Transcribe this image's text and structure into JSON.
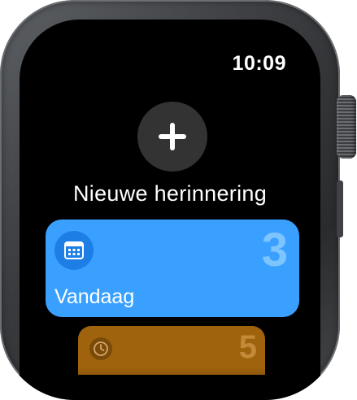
{
  "status": {
    "time": "10:09"
  },
  "add": {
    "icon": "plus-icon",
    "label": "Nieuwe herinnering"
  },
  "lists": [
    {
      "icon": "calendar-icon",
      "count": "3",
      "label": "Vandaag",
      "color": "#3aa0ff"
    },
    {
      "icon": "clock-icon",
      "count": "5",
      "color": "#a0630d"
    }
  ]
}
